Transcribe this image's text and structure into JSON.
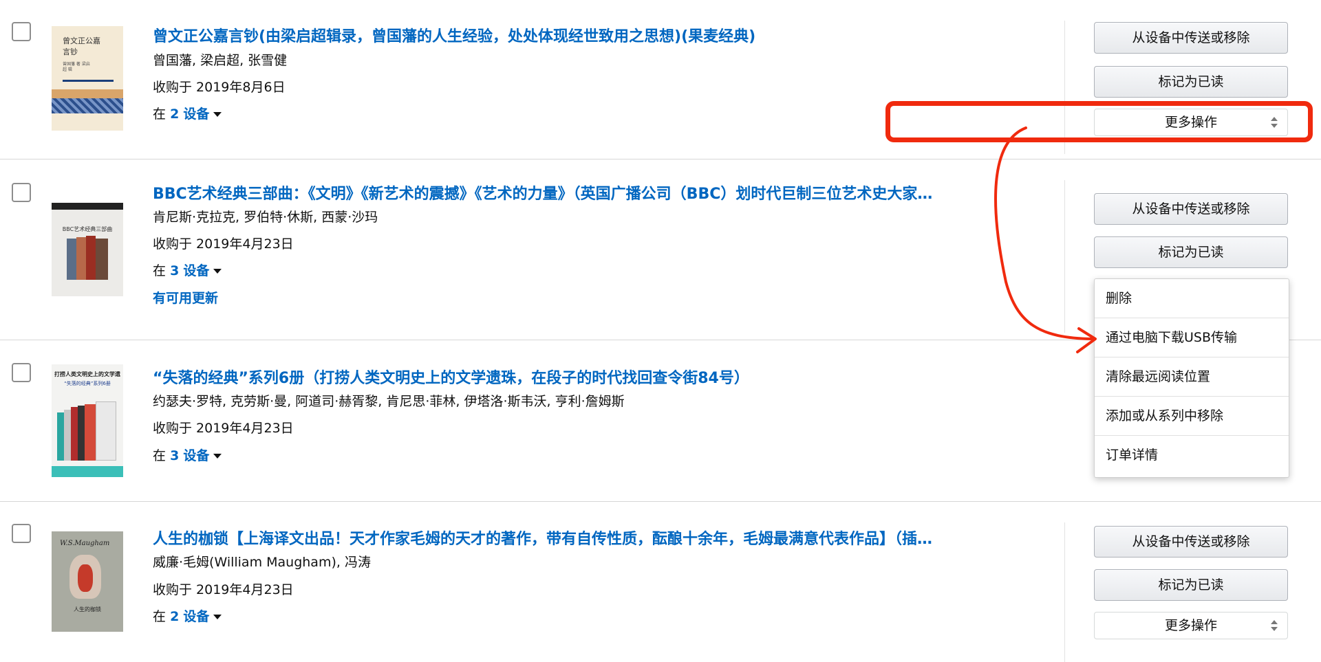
{
  "books": [
    {
      "title": "曾文正公嘉言钞(由梁启超辑录，曾国藩的人生经验，处处体现经世致用之思想)(果麦经典)",
      "authors": "曾国藩, 梁启超, 张雪健",
      "purchased": "收购于 2019年8月6日",
      "devices_prefix": "在",
      "devices_count": "2",
      "devices_label": "设备",
      "cover_text": "曾文正公嘉言钞",
      "cover_sub": "曾国藩 著 梁启超 辑"
    },
    {
      "title": "BBC艺术经典三部曲：《文明》《新艺术的震撼》《艺术的力量》（英国广播公司（BBC）划时代巨制三位艺术史大家…",
      "authors": "肯尼斯·克拉克, 罗伯特·休斯, 西蒙·沙玛",
      "purchased": "收购于 2019年4月23日",
      "devices_prefix": "在",
      "devices_count": "3",
      "devices_label": "设备",
      "update": "有可用更新",
      "cover_text": "BBC艺术经典三部曲"
    },
    {
      "title": "“失落的经典”系列6册（打捞人类文明史上的文学遗珠，在段子的时代找回查令街84号）",
      "authors": "约瑟夫·罗特, 克劳斯·曼, 阿道司·赫胥黎, 肯尼思·菲林, 伊塔洛·斯韦沃, 亨利·詹姆斯",
      "purchased": "收购于 2019年4月23日",
      "devices_prefix": "在",
      "devices_count": "3",
      "devices_label": "设备",
      "cover_text": "打捞人类文明史上的文学遗珠",
      "cover_sub": "“失落的经典”系列6册"
    },
    {
      "title": "人生的枷锁【上海译文出品！天才作家毛姆的天才的著作，带有自传性质，酝酿十余年，毛姆最满意代表作品】（插…",
      "authors": "威廉·毛姆(William Maugham), 冯涛",
      "purchased": "收购于 2019年4月23日",
      "devices_prefix": "在",
      "devices_count": "2",
      "devices_label": "设备",
      "cover_text": "W.S.Maugham",
      "cover_sub": "人生的枷锁"
    }
  ],
  "actions": {
    "send_remove": "从设备中传送或移除",
    "mark_read": "标记为已读",
    "more": "更多操作"
  },
  "dropdown": {
    "items": [
      "删除",
      "通过电脑下载USB传输",
      "清除最远阅读位置",
      "添加或从系列中移除",
      "订单详情"
    ]
  },
  "colors": {
    "link": "#0066c0",
    "annotation": "#f02a0e",
    "divider": "#d6d6d6"
  }
}
